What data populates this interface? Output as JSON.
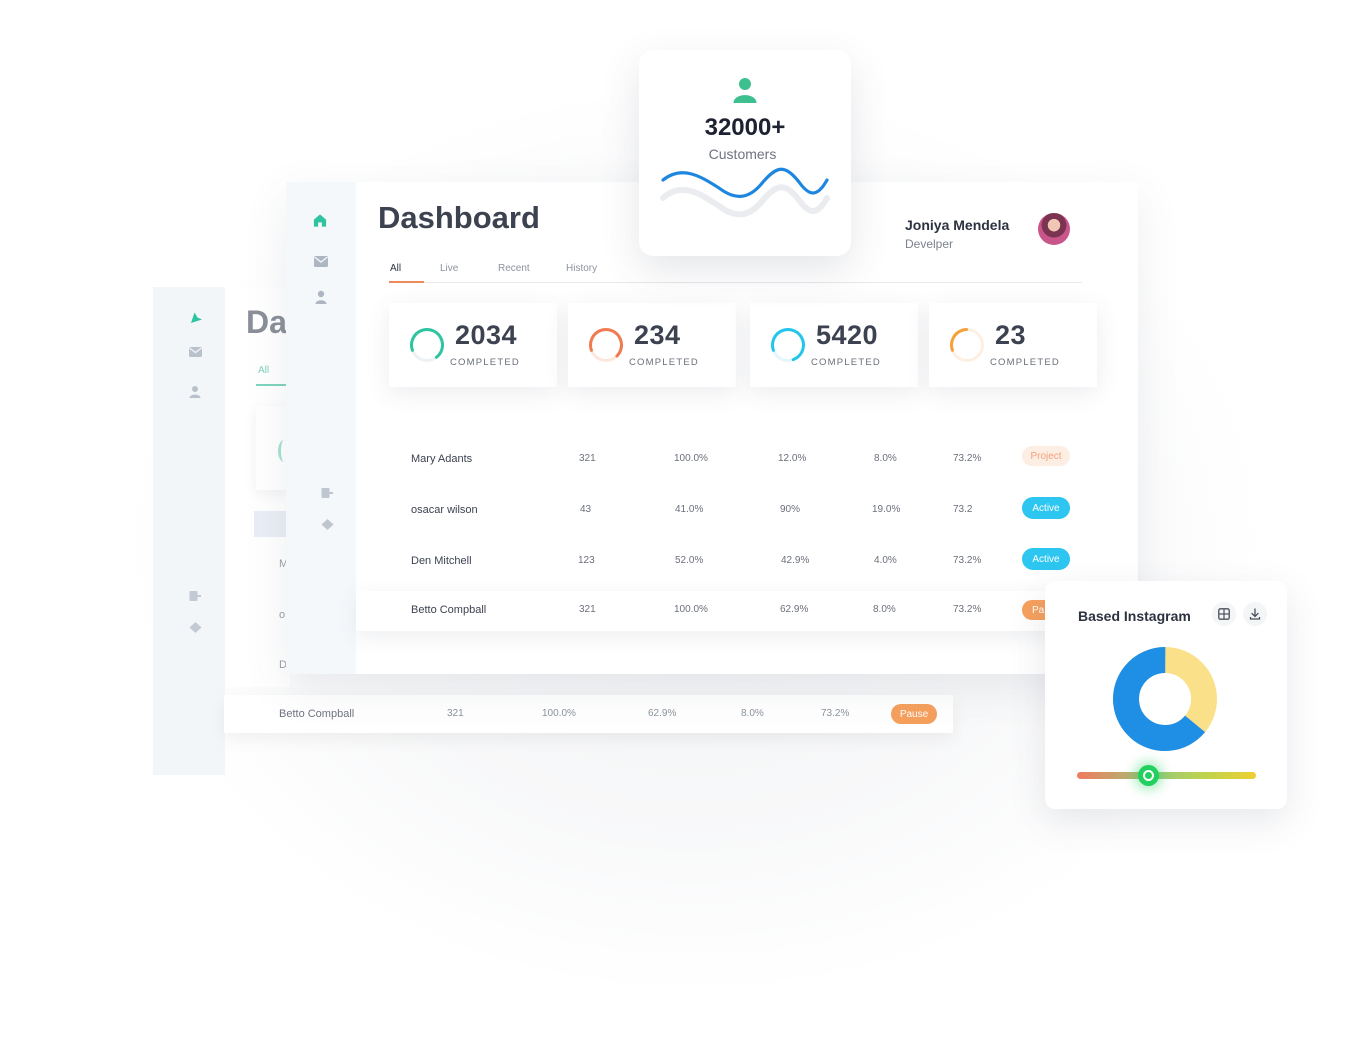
{
  "customers": {
    "count": "32000+",
    "label": "Customers"
  },
  "dashboard": {
    "title": "Dashboard",
    "tabs": [
      "All",
      "Live",
      "Recent",
      "History"
    ],
    "user": {
      "name": "Joniya Mendela",
      "role": "Develper"
    }
  },
  "stats": [
    {
      "value": "2034",
      "label": "COMPLETED",
      "color": "#2ec4a0",
      "progress": 0.7
    },
    {
      "value": "234",
      "label": "COMPLETED",
      "color": "#f07b4f",
      "progress": 0.68
    },
    {
      "value": "5420",
      "label": "COMPLETED",
      "color": "#23c6ea",
      "progress": 0.75
    },
    {
      "value": "23",
      "label": "COMPLETED",
      "color": "#f5a13a",
      "progress": 0.3
    }
  ],
  "table": {
    "rows": [
      {
        "name": "Mary Adants",
        "c1": "321",
        "c2": "100.0%",
        "c3": "12.0%",
        "c4": "8.0%",
        "c5": "73.2%",
        "status": "Project"
      },
      {
        "name": "osacar wilson",
        "c1": "43",
        "c2": "41.0%",
        "c3": "90%",
        "c4": "19.0%",
        "c5": "73.2",
        "status": "Active"
      },
      {
        "name": "Den Mitchell",
        "c1": "123",
        "c2": "52.0%",
        "c3": "42.9%",
        "c4": "4.0%",
        "c5": "73.2%",
        "status": "Active"
      },
      {
        "name": "Betto Compball",
        "c1": "321",
        "c2": "100.0%",
        "c3": "62.9%",
        "c4": "8.0%",
        "c5": "73.2%",
        "status": "Pa"
      }
    ]
  },
  "back_dashboard": {
    "title": "Da",
    "tab": "All",
    "letters": [
      "M",
      "o",
      "D"
    ],
    "row": {
      "name": "Betto Compball",
      "c1": "321",
      "c2": "100.0%",
      "c3": "62.9%",
      "c4": "8.0%",
      "c5": "73.2%",
      "status": "Pause"
    }
  },
  "instagram": {
    "title": "Based Instagram",
    "donut": {
      "blue_share": 0.64,
      "yellow_share": 0.36
    },
    "slider_value": 0.4
  },
  "colors": {
    "accent_green": "#3dbf8f",
    "active": "#2cc6f0",
    "project_bg": "#fdeee4",
    "project_text": "#f2a07c",
    "pause": "#f6a05d",
    "wave": "#1f86e0",
    "donut_blue": "#1f8fe6",
    "donut_yellow": "#fbe08a"
  },
  "icons": [
    "home-icon",
    "mail-icon",
    "user-icon",
    "logout-icon",
    "layers-icon",
    "cursor-icon",
    "grid-icon",
    "download-icon"
  ]
}
